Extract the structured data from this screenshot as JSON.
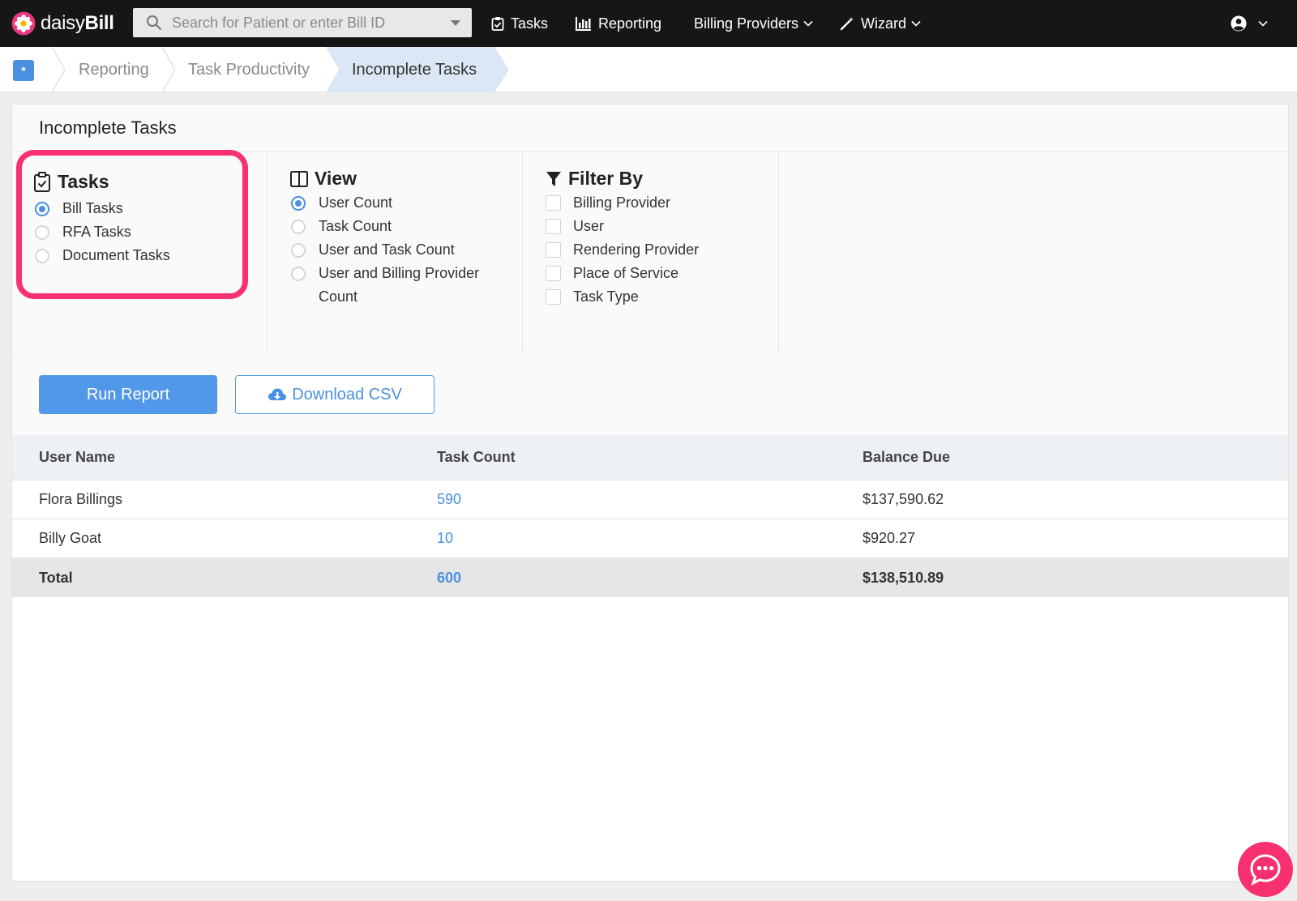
{
  "topbar": {
    "brand_light": "daisy",
    "brand_bold": "Bill",
    "search_placeholder": "Search for Patient or enter Bill ID",
    "nav": {
      "tasks": "Tasks",
      "reporting": "Reporting",
      "billing_providers": "Billing Providers",
      "wizard": "Wizard"
    }
  },
  "breadcrumb": {
    "items": [
      "Reporting",
      "Task Productivity"
    ],
    "active": "Incomplete Tasks"
  },
  "page": {
    "title": "Incomplete Tasks"
  },
  "tasks": {
    "heading": "Tasks",
    "options": [
      "Bill Tasks",
      "RFA Tasks",
      "Document Tasks"
    ],
    "selected": "Bill Tasks"
  },
  "view": {
    "heading": "View",
    "options": [
      "User Count",
      "Task Count",
      "User and Task Count",
      "User and Billing Provider",
      "Count"
    ],
    "selected": "User Count"
  },
  "filter": {
    "heading": "Filter By",
    "options": [
      "Billing Provider",
      "User",
      "Rendering Provider",
      "Place of Service",
      "Task Type"
    ]
  },
  "actions": {
    "run": "Run Report",
    "csv": "Download CSV"
  },
  "table": {
    "columns": [
      "User Name",
      "Task Count",
      "Balance Due"
    ],
    "rows": [
      [
        "Flora Billings",
        "590",
        "$137,590.62"
      ],
      [
        "Billy Goat",
        "10",
        "$920.27"
      ]
    ],
    "total": [
      "Total",
      "600",
      "$138,510.89"
    ]
  },
  "colors": {
    "accent": "#4a90e2",
    "highlight": "#f7306f",
    "topbar": "#161616"
  }
}
